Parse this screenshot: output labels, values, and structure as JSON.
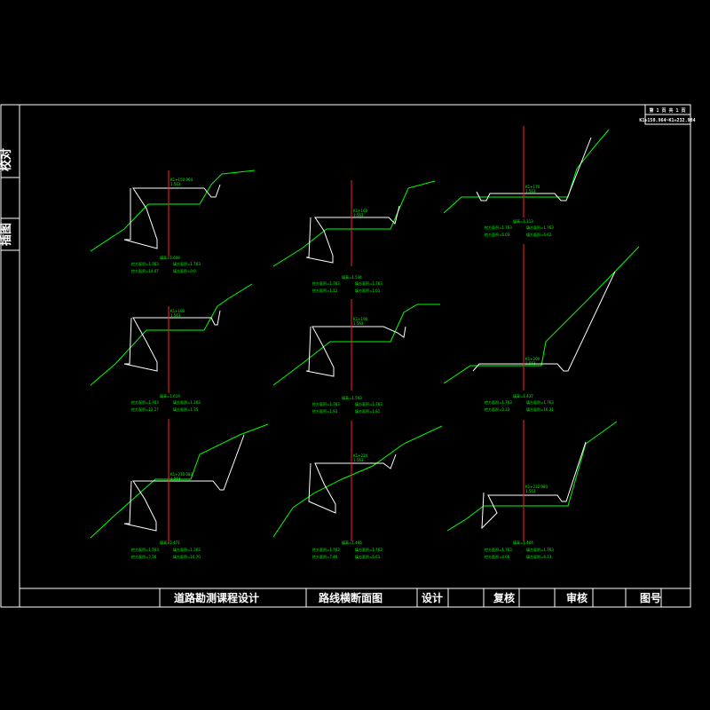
{
  "side_labels": {
    "check": "校对",
    "insert": "插图"
  },
  "corner": {
    "page": "第 1 页  共 1 页",
    "range": "K1+150.964~K1+232.984"
  },
  "title_block": {
    "course": "道路勘测课程设计",
    "drawing": "路线横断面图",
    "design": "设计",
    "review": "复核",
    "audit": "审核",
    "number": "图号"
  },
  "colors": {
    "ground": "#00ff00",
    "design": "#ffffff",
    "centerline": "#ff2020",
    "background": "#000000"
  },
  "sections": [
    {
      "station": "K1+150.964",
      "elev": "1.563",
      "fill": "填高=1.608",
      "l1": "挖方面积=1.763",
      "l2": "填方面积=1.763",
      "l3": "挖方面积=14.07",
      "l4": "填方面积=0.0"
    },
    {
      "station": "K1+160",
      "elev": "1.563",
      "fill": "填高=1.534",
      "l1": "挖方面积=1.763",
      "l2": "填方面积=1.763",
      "l3": "挖方面积=1.12",
      "l4": "填方面积=1.01"
    },
    {
      "station": "K1+170",
      "elev": "1.563",
      "fill": "填高=1.213",
      "l1": "挖方面积=1.763",
      "l2": "填方面积=1.763",
      "l3": "挖方面积=6.03",
      "l4": "填方面积=6.62"
    },
    {
      "station": "K1+180",
      "elev": "1.563",
      "fill": "填高=1.619",
      "l1": "挖方面积=1.763",
      "l2": "填方面积=1.203",
      "l3": "挖方面积=12.17",
      "l4": "填方面积=1.35"
    },
    {
      "station": "K1+190",
      "elev": "1.563",
      "fill": "填高=1.503",
      "l1": "挖方面积=1.763",
      "l2": "填方面积=1.763",
      "l3": "挖方面积=1.93",
      "l4": "填方面积=1.81"
    },
    {
      "station": "K1+200",
      "elev": "1.563",
      "fill": "填高=1.437",
      "l1": "挖方面积=1.763",
      "l2": "填方面积=1.763",
      "l3": "挖方面积=0.33",
      "l4": "填方面积=16.31"
    },
    {
      "station": "K1+210.083",
      "elev": "1.563",
      "fill": "填高=1.471",
      "l1": "挖方面积=1.763",
      "l2": "填方面积=1.303",
      "l3": "挖方面积=7.76",
      "l4": "填方面积=10.70"
    },
    {
      "station": "K1+220",
      "elev": "1.563",
      "fill": "填高=1.466",
      "l1": "挖方面积=1.763",
      "l2": "填方面积=1.763",
      "l3": "挖方面积=7.46",
      "l4": "填方面积=6.61"
    },
    {
      "station": "K1+232.984",
      "elev": "1.563",
      "fill": "填高=1.404",
      "l1": "挖方面积=1.763",
      "l2": "填方面积=1.763",
      "l3": "挖方面积=4.66",
      "l4": "填方面积=6.33"
    }
  ]
}
